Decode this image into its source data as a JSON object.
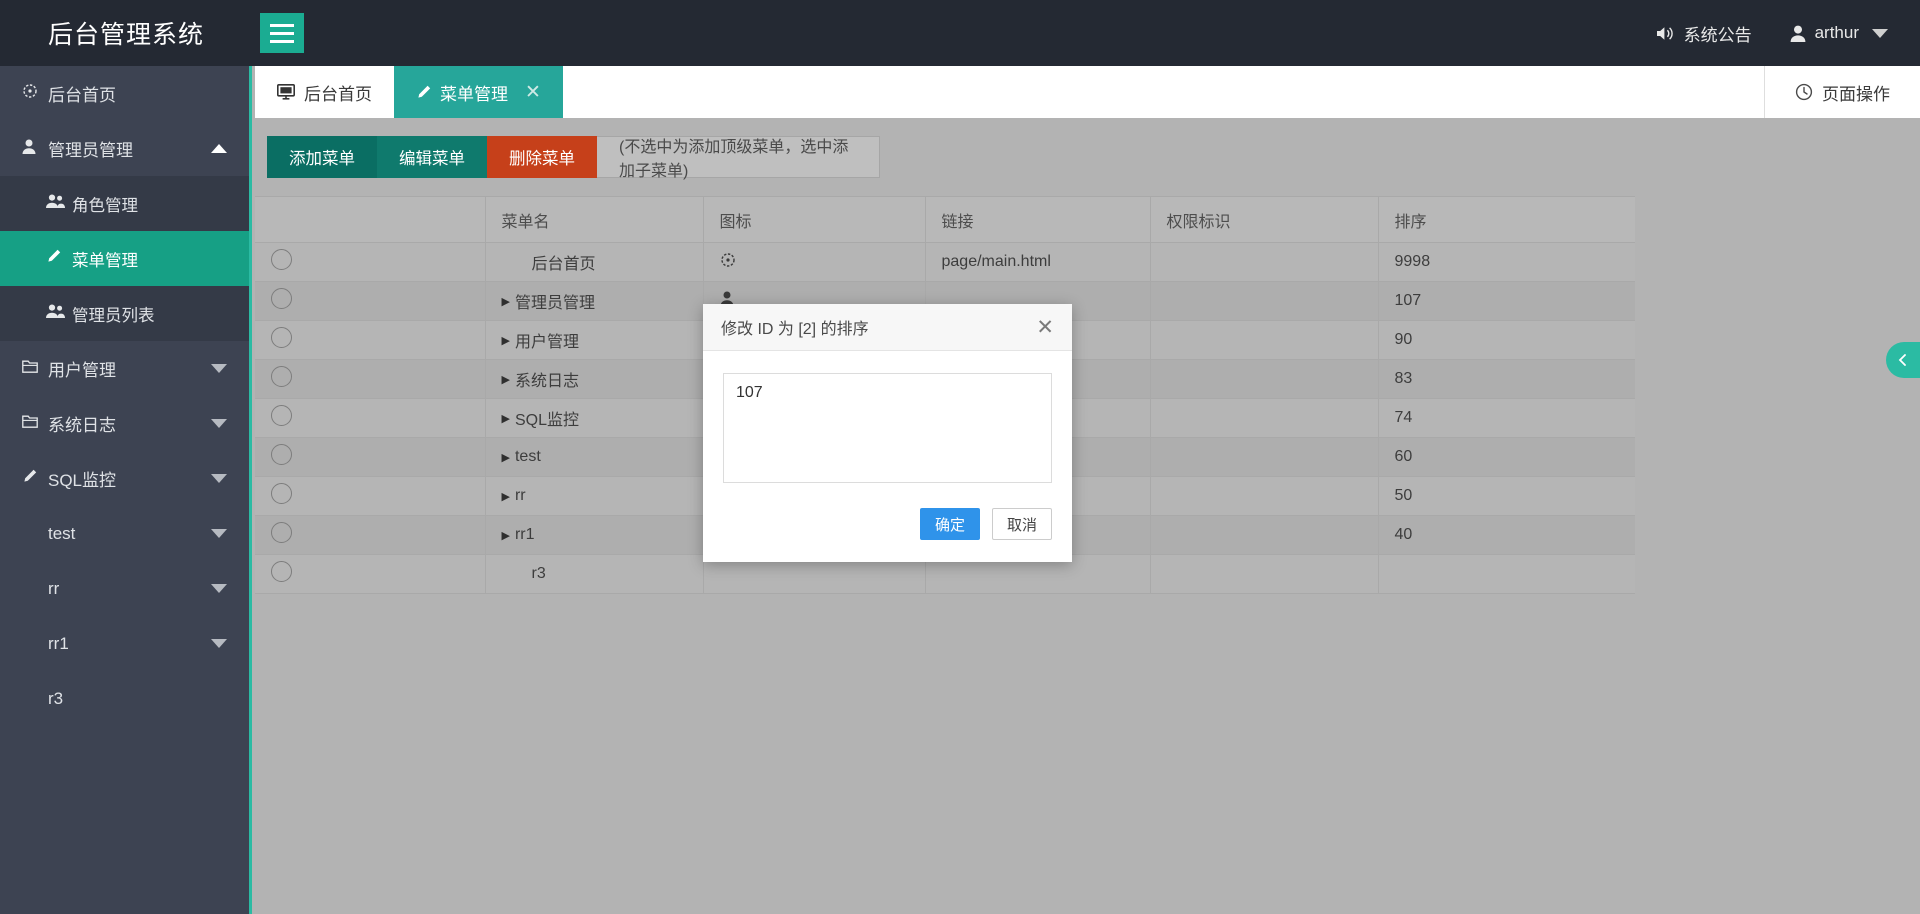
{
  "header": {
    "logo": "后台管理系统",
    "hamburger_icon": "hamburger-icon",
    "notice_label": "系统公告",
    "notice_icon": "speaker-icon",
    "user_name": "arthur",
    "user_icon": "user-icon"
  },
  "sidebar": {
    "items": [
      {
        "label": "后台首页",
        "icon": "dashboard-icon",
        "caret": "",
        "level": "top",
        "active": false
      },
      {
        "label": "管理员管理",
        "icon": "user-icon",
        "caret": "up",
        "level": "top",
        "active": false
      },
      {
        "label": "角色管理",
        "icon": "users-icon",
        "caret": "",
        "level": "sub",
        "active": false
      },
      {
        "label": "菜单管理",
        "icon": "pencil-icon",
        "caret": "",
        "level": "sub",
        "active": true
      },
      {
        "label": "管理员列表",
        "icon": "users-icon",
        "caret": "",
        "level": "sub",
        "active": false
      },
      {
        "label": "用户管理",
        "icon": "folder-icon",
        "caret": "down",
        "level": "top",
        "active": false
      },
      {
        "label": "系统日志",
        "icon": "folder-icon",
        "caret": "down",
        "level": "top",
        "active": false
      },
      {
        "label": "SQL监控",
        "icon": "pencil-icon",
        "caret": "down",
        "level": "top",
        "active": false
      },
      {
        "label": "test",
        "icon": "",
        "caret": "down",
        "level": "top",
        "active": false
      },
      {
        "label": "rr",
        "icon": "",
        "caret": "down",
        "level": "top",
        "active": false
      },
      {
        "label": "rr1",
        "icon": "",
        "caret": "down",
        "level": "top",
        "active": false
      },
      {
        "label": "r3",
        "icon": "",
        "caret": "",
        "level": "top",
        "active": false
      }
    ]
  },
  "tabs": [
    {
      "label": "后台首页",
      "icon": "monitor-icon",
      "active": false,
      "closable": false
    },
    {
      "label": "菜单管理",
      "icon": "pencil-icon",
      "active": true,
      "closable": true
    }
  ],
  "page_operation": {
    "label": "页面操作",
    "icon": "clock-icon"
  },
  "toolbar": {
    "add_label": "添加菜单",
    "edit_label": "编辑菜单",
    "delete_label": "删除菜单",
    "hint": "(不选中为添加顶级菜单，选中添加子菜单)"
  },
  "table": {
    "columns": [
      "",
      "菜单名",
      "图标",
      "链接",
      "权限标识",
      "排序"
    ],
    "rows": [
      {
        "name": "后台首页",
        "child": false,
        "icon": "dashboard-icon",
        "link": "page/main.html",
        "perm": "",
        "sort": "9998"
      },
      {
        "name": "管理员管理",
        "child": true,
        "icon": "user-icon",
        "link": "",
        "perm": "",
        "sort": "107"
      },
      {
        "name": "用户管理",
        "child": true,
        "icon": "folder-icon",
        "link": "",
        "perm": "",
        "sort": "90"
      },
      {
        "name": "系统日志",
        "child": true,
        "icon": "folder-icon",
        "link": "",
        "perm": "",
        "sort": "83"
      },
      {
        "name": "SQL监控",
        "child": true,
        "icon": "pencil-icon",
        "link": "",
        "perm": "",
        "sort": "74"
      },
      {
        "name": "test",
        "child": true,
        "icon": "",
        "link": "",
        "perm": "",
        "sort": "60"
      },
      {
        "name": "rr",
        "child": true,
        "icon": "",
        "link": "",
        "perm": "",
        "sort": "50"
      },
      {
        "name": "rr1",
        "child": true,
        "icon": "",
        "link": "",
        "perm": "",
        "sort": "40"
      },
      {
        "name": "r3",
        "child": false,
        "icon": "",
        "link": "",
        "perm": "",
        "sort": ""
      }
    ]
  },
  "modal": {
    "title": "修改 ID 为 [2] 的排序",
    "close_icon": "close-icon",
    "value": "107",
    "placeholder": "",
    "confirm_label": "确定",
    "cancel_label": "取消"
  },
  "colors": {
    "accent": "#1bac92",
    "sidebar_bg": "#3d4352",
    "header_bg": "#242933",
    "danger": "#c6401a",
    "primary_btn": "#2f93ea"
  }
}
